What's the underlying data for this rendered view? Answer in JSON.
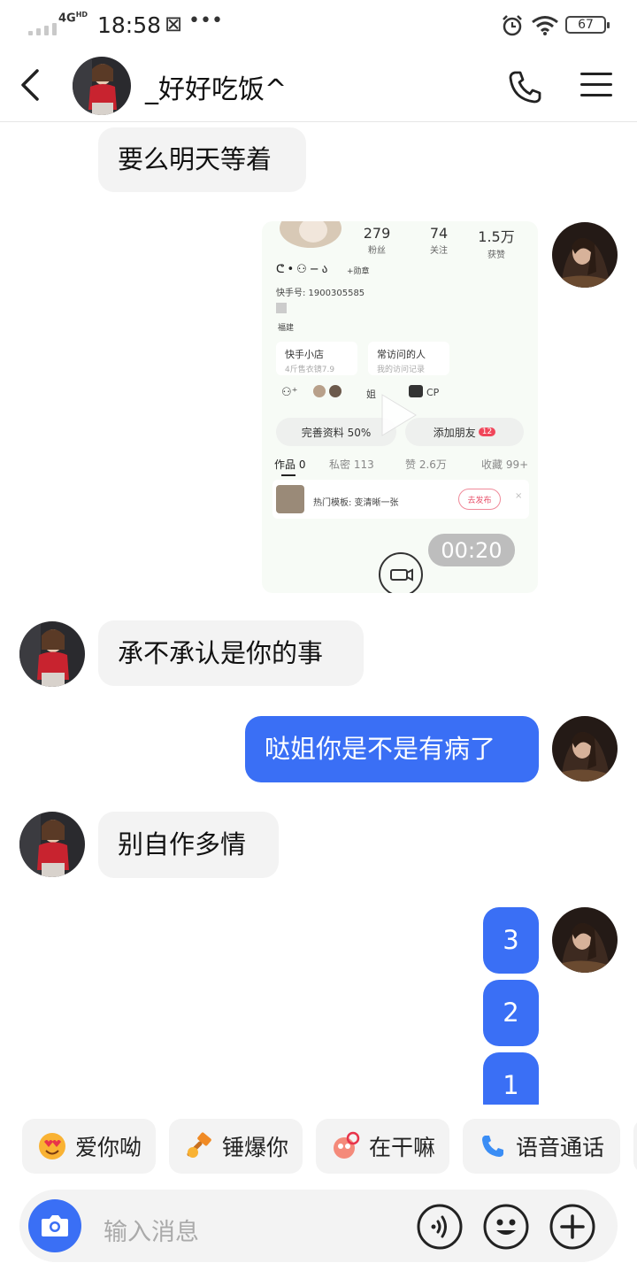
{
  "status_bar": {
    "network": "4G",
    "network_sup": "HD",
    "time": "18:58",
    "battery": "67"
  },
  "header": {
    "title": "_好好吃饭^"
  },
  "messages": [
    {
      "side": "in",
      "text": "要么明天等着"
    },
    {
      "side": "out",
      "type": "video",
      "duration": "00:20"
    },
    {
      "side": "in",
      "text": "承不承认是你的事"
    },
    {
      "side": "out",
      "text": "哒姐你是不是有病了"
    },
    {
      "side": "in",
      "text": "别自作多情"
    },
    {
      "side": "out",
      "text": "3"
    },
    {
      "side": "out",
      "text": "2"
    },
    {
      "side": "out",
      "text": "1"
    }
  ],
  "video_preview": {
    "stats": [
      {
        "value": "279",
        "label": "粉丝"
      },
      {
        "value": "74",
        "label": "关注"
      },
      {
        "value": "1.5万",
        "label": "获赞"
      }
    ],
    "id_line": "快手号: 1900305585",
    "location": "福建",
    "badge": "+勋章",
    "shop": {
      "title": "快手小店",
      "sub": "4斤售衣镜7.9"
    },
    "visitors": {
      "title": "常访问的人",
      "sub": "我的访问记录"
    },
    "relation_tags": [
      "姐",
      "CP"
    ],
    "complete_profile": "完善资料 50%",
    "add_friend": "添加朋友",
    "add_friend_count": "12",
    "tabs": [
      "作品 0",
      "私密 113",
      "赞 2.6万",
      "收藏 99+"
    ],
    "template_text": "热门模板: 变清晰一张",
    "publish": "去发布"
  },
  "quick_replies": [
    {
      "label": "爱你呦",
      "icon": "heart-eyes-emoji-icon"
    },
    {
      "label": "锤爆你",
      "icon": "hammer-emoji-icon"
    },
    {
      "label": "在干嘛",
      "icon": "curious-emoji-icon"
    },
    {
      "label": "语音通话",
      "icon": "phone-icon"
    }
  ],
  "input": {
    "placeholder": "输入消息"
  },
  "colors": {
    "accent": "#3a6ff5",
    "incoming_bubble": "#f3f3f3"
  }
}
